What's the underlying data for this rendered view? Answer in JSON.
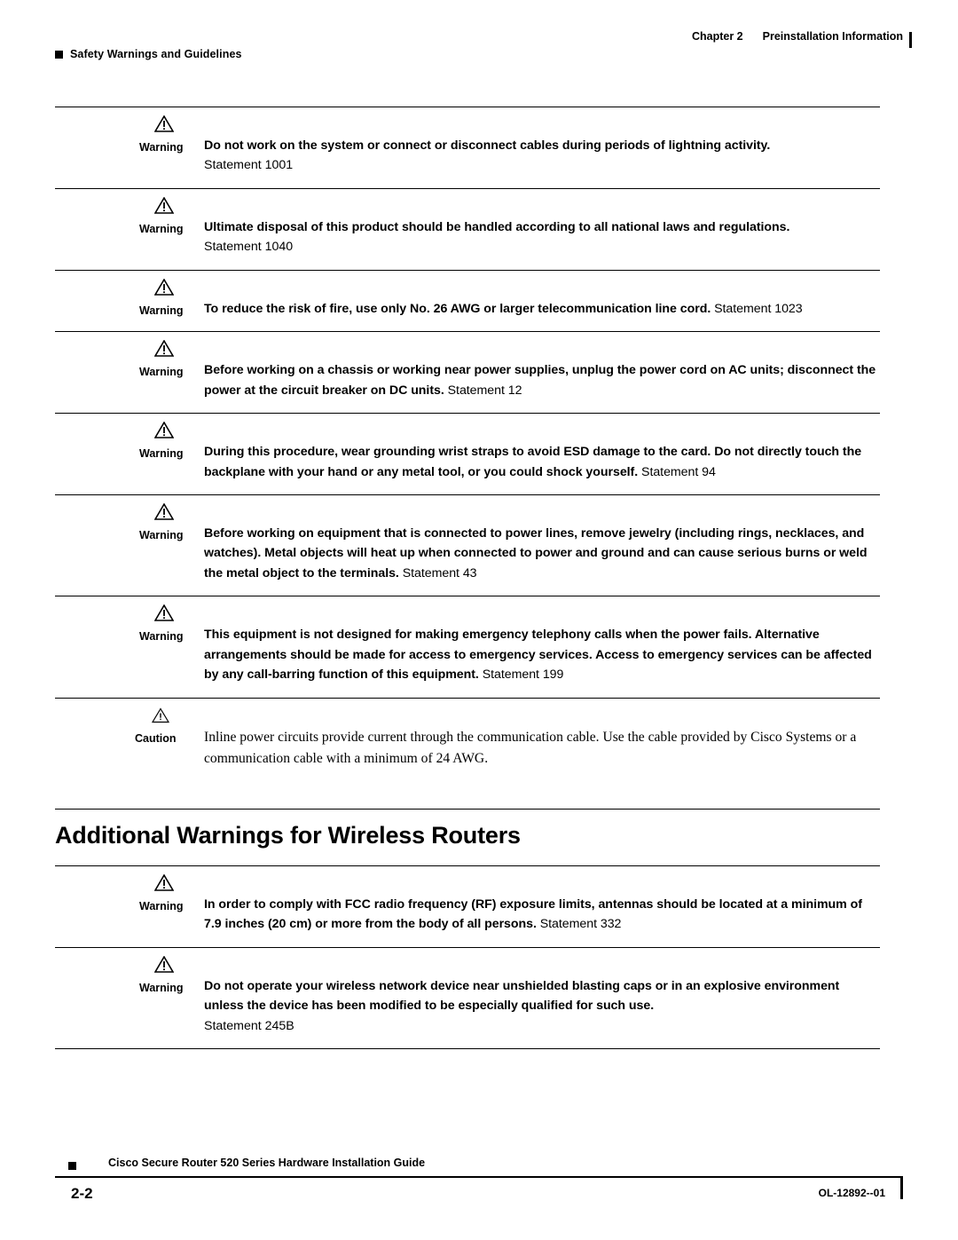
{
  "header": {
    "left_label": "Safety Warnings and Guidelines",
    "chapter": "Chapter 2",
    "chapter_title": "Preinstallation Information"
  },
  "warnings": [
    {
      "label": "Warning",
      "icon": "warning-triangle-icon",
      "text": "Do not work on the system or connect or disconnect cables during periods of lightning activity.",
      "statement_block": "Statement 1001",
      "statement_inline": ""
    },
    {
      "label": "Warning",
      "icon": "warning-triangle-icon",
      "text": "Ultimate disposal of this product should be handled according to all national laws and regulations.",
      "statement_block": "Statement 1040",
      "statement_inline": ""
    },
    {
      "label": "Warning",
      "icon": "warning-triangle-icon",
      "text": "To reduce the risk of fire, use only No. 26 AWG or larger telecommunication line cord.",
      "statement_block": "",
      "statement_inline": "Statement 1023"
    },
    {
      "label": "Warning",
      "icon": "warning-triangle-icon",
      "text": "Before working on a chassis or working near power supplies, unplug the power cord on AC units; disconnect the power at the circuit breaker on DC units.",
      "statement_block": "",
      "statement_inline": "Statement 12"
    },
    {
      "label": "Warning",
      "icon": "warning-triangle-icon",
      "text": "During this procedure, wear grounding wrist straps to avoid ESD damage to the card. Do not directly touch the backplane with your hand or any metal tool, or you could shock yourself.",
      "statement_block": "",
      "statement_inline": "Statement 94"
    },
    {
      "label": "Warning",
      "icon": "warning-triangle-icon",
      "text": "Before working on equipment that is connected to power lines, remove jewelry (including rings, necklaces, and watches). Metal objects will heat up when connected to power and ground and can cause serious burns or weld the metal object to the terminals.",
      "statement_block": "",
      "statement_inline": "Statement 43"
    },
    {
      "label": "Warning",
      "icon": "warning-triangle-icon",
      "text": "This equipment is not designed for making emergency telephony calls when the power fails. Alternative arrangements should be made for access to emergency services. Access to emergency services can be affected by any call-barring function of this equipment.",
      "statement_block": "",
      "statement_inline": "Statement 199"
    }
  ],
  "caution": {
    "label": "Caution",
    "icon": "caution-triangle-icon",
    "text": "Inline power circuits provide current through the communication cable. Use the cable provided by Cisco Systems or a communication cable with a minimum of 24 AWG."
  },
  "section": {
    "heading": "Additional Warnings for Wireless Routers"
  },
  "wireless_warnings": [
    {
      "label": "Warning",
      "icon": "warning-triangle-icon",
      "text": "In order to comply with FCC radio frequency (RF) exposure limits, antennas should be located at a minimum of 7.9 inches (20 cm) or more from the body of all persons.",
      "statement_block": "",
      "statement_inline": "Statement 332"
    },
    {
      "label": "Warning",
      "icon": "warning-triangle-icon",
      "text": "Do not operate your wireless network device near unshielded blasting caps or in an explosive environment unless the device has been modified to be especially qualified for such use.",
      "statement_block": "Statement 245B",
      "statement_inline": ""
    }
  ],
  "footer": {
    "title": "Cisco Secure Router 520 Series Hardware Installation Guide",
    "page_number": "2-2",
    "doc_id": "OL-12892--01"
  }
}
